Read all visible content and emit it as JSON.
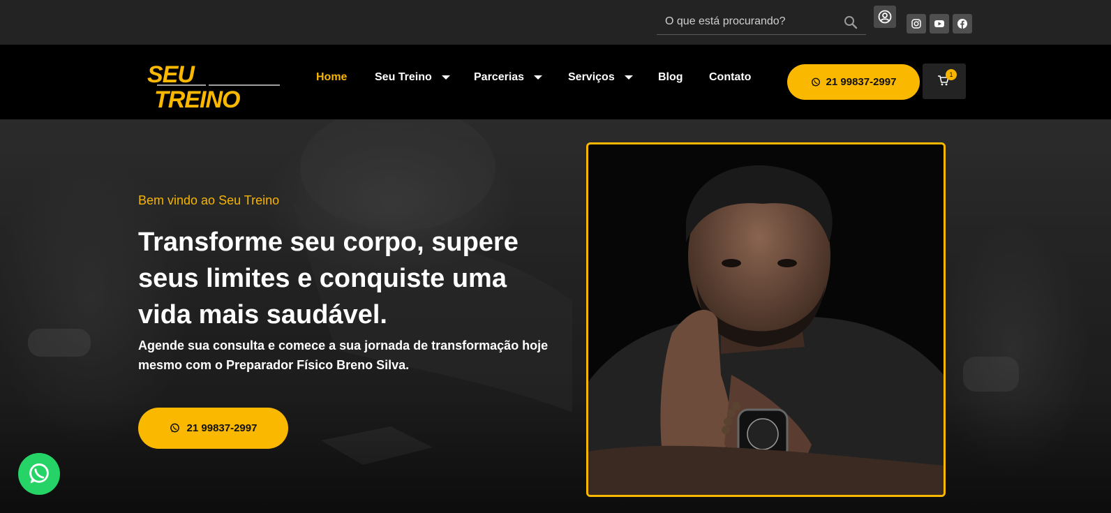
{
  "topbar": {
    "search_placeholder": "O que está procurando?",
    "icons": [
      "search-icon",
      "user-icon",
      "instagram-icon",
      "youtube-icon",
      "facebook-icon"
    ]
  },
  "brand": {
    "logo_line1": "SEU",
    "logo_line2": "TREINO",
    "accent_color": "#fbb800"
  },
  "nav": {
    "items": [
      {
        "label": "Home",
        "active": true
      },
      {
        "label": "Seu Treino",
        "dropdown": true
      },
      {
        "label": "Parcerias",
        "dropdown": true
      },
      {
        "label": "Serviços",
        "dropdown": true
      },
      {
        "label": "Blog"
      },
      {
        "label": "Contato"
      }
    ],
    "cta_label": "21 99837-2997",
    "cart_count": "1"
  },
  "hero": {
    "eyebrow": "Bem vindo ao Seu Treino",
    "headline": "Transforme seu corpo, supere seus limites e conquiste uma vida mais saudável.",
    "subtitle": "Agende sua consulta e comece a sua jornada de transformação hoje mesmo com o Preparador Físico Breno Silva.",
    "cta_label": "21 99837-2997"
  }
}
